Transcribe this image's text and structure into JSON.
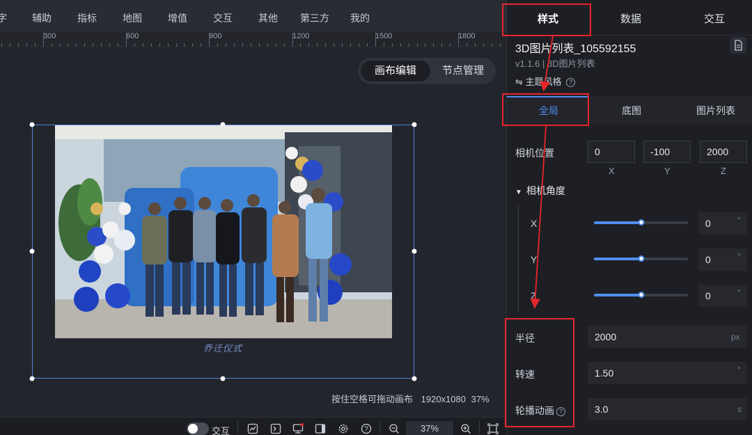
{
  "top_menu": [
    "字",
    "辅助",
    "指标",
    "地图",
    "增值",
    "交互",
    "其他",
    "第三方",
    "我的"
  ],
  "ruler": {
    "labels": [
      "300",
      "600",
      "900",
      "1200",
      "1500",
      "1800"
    ]
  },
  "canvas": {
    "mode_tabs": [
      "画布编辑",
      "节点管理"
    ],
    "photo_caption": "乔迁仪式",
    "status_hint": "按住空格可拖动画布",
    "resolution": "1920x1080",
    "zoom_percent": "37%"
  },
  "bottom_bar": {
    "interaction_label": "交互",
    "zoom_value": "37%",
    "icons": [
      "chart-icon",
      "terminal-icon",
      "monitor-icon",
      "panel-icon",
      "settings-icon",
      "help-icon",
      "zoom-out-icon",
      "zoom-in-icon",
      "fit-screen-icon"
    ]
  },
  "panel": {
    "tabs": [
      "样式",
      "数据",
      "交互"
    ],
    "component_title": "3D图片列表_105592155",
    "component_subtitle": "v1.1.6 | 3D图片列表",
    "theme_label": "主题风格",
    "sub_tabs": [
      "全局",
      "底图",
      "图片列表"
    ],
    "camera_position": {
      "label": "相机位置",
      "x": "0",
      "y": "-100",
      "z": "2000",
      "axes": [
        "X",
        "Y",
        "Z"
      ]
    },
    "camera_angle": {
      "label": "相机角度",
      "rows": [
        {
          "axis": "X",
          "value": "0",
          "unit": "°",
          "level": 0.5
        },
        {
          "axis": "Y",
          "value": "0",
          "unit": "°",
          "level": 0.5
        },
        {
          "axis": "Z",
          "value": "0",
          "unit": "°",
          "level": 0.5
        }
      ]
    },
    "radius": {
      "label": "半径",
      "value": "2000",
      "unit": "px"
    },
    "speed": {
      "label": "转速",
      "value": "1.50",
      "unit": "°"
    },
    "carousel": {
      "label": "轮播动画",
      "value": "3.0",
      "unit": "s"
    }
  },
  "colors": {
    "accent": "#4f8ef2",
    "annotation": "#e8262b",
    "selection": "#4f84d6"
  }
}
